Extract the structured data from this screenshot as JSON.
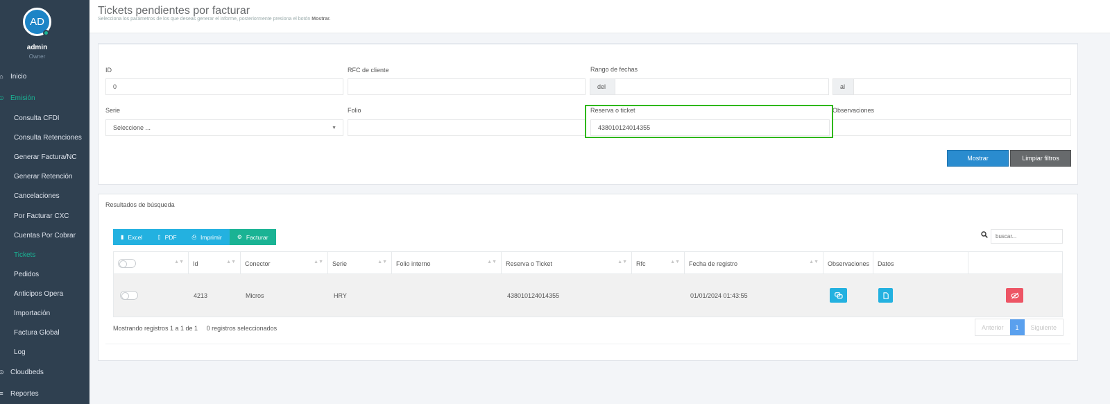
{
  "user": {
    "initials": "AD",
    "name": "admin",
    "role": "Owner"
  },
  "sidebar": {
    "items": [
      {
        "label": "Inicio",
        "icon": "home-icon",
        "glyph": "⌂",
        "level": "top",
        "active": false
      },
      {
        "label": "Emisión",
        "icon": "circle-arrow-icon",
        "glyph": "⊙",
        "level": "top",
        "active": true
      },
      {
        "label": "Consulta CFDI",
        "level": "sub",
        "active": false
      },
      {
        "label": "Consulta Retenciones",
        "level": "sub",
        "active": false
      },
      {
        "label": "Generar Factura/NC",
        "level": "sub",
        "active": false
      },
      {
        "label": "Generar Retención",
        "level": "sub",
        "active": false
      },
      {
        "label": "Cancelaciones",
        "level": "sub",
        "active": false
      },
      {
        "label": "Por Facturar CXC",
        "level": "sub",
        "active": false
      },
      {
        "label": "Cuentas Por Cobrar",
        "level": "sub",
        "active": false
      },
      {
        "label": "Tickets",
        "level": "sub",
        "active": true
      },
      {
        "label": "Pedidos",
        "level": "sub",
        "active": false
      },
      {
        "label": "Anticipos Opera",
        "level": "sub",
        "active": false
      },
      {
        "label": "Importación",
        "level": "sub",
        "active": false
      },
      {
        "label": "Factura Global",
        "level": "sub",
        "active": false
      },
      {
        "label": "Log",
        "level": "sub",
        "active": false
      },
      {
        "label": "Cloudbeds",
        "icon": "circle-arrow-icon",
        "glyph": "⊙",
        "level": "top",
        "active": false
      },
      {
        "label": "Reportes",
        "icon": "list-icon",
        "glyph": "≡",
        "level": "top",
        "active": false
      }
    ]
  },
  "header": {
    "title": "Tickets pendientes por facturar",
    "subtitle_pre": "Selecciona los parámetros de los que deseas generar el informe, posteriormente presiona el botón",
    "subtitle_bold": "Mostrar."
  },
  "filters": {
    "id_label": "ID",
    "id_value": "0",
    "rfc_label": "RFC de cliente",
    "rfc_value": "",
    "range_label": "Rango de fechas",
    "range_from_addon": "del",
    "range_to_addon": "al",
    "serie_label": "Serie",
    "serie_value": "Seleccione ...",
    "folio_label": "Folio",
    "folio_value": "",
    "reserva_label": "Reserva o ticket",
    "reserva_value": "438010124014355",
    "obs_label": "Observaciones",
    "obs_value": "",
    "show_button": "Mostrar",
    "clear_button": "Limpiar filtros"
  },
  "results": {
    "title": "Resultados de búsqueda",
    "toolbar": {
      "excel": "Excel",
      "pdf": "PDF",
      "print": "Imprimir",
      "invoice": "Facturar"
    },
    "search_placeholder": "buscar...",
    "columns": [
      "Id",
      "Conector",
      "Serie",
      "Folio interno",
      "Reserva o Ticket",
      "Rfc",
      "Fecha de registro",
      "Observaciones",
      "Datos"
    ],
    "rows": [
      {
        "id": "4213",
        "conector": "Micros",
        "serie": "HRY",
        "folio_interno": "",
        "reserva": "438010124014355",
        "rfc": "",
        "fecha": "01/01/2024 01:43:55"
      }
    ],
    "info": "Mostrando registros 1 a 1 de 1",
    "selected": "0 registros seleccionados",
    "pager": {
      "prev": "Anterior",
      "current": "1",
      "next": "Siguiente"
    }
  },
  "colors": {
    "sidebar_bg": "#2f4050",
    "accent_green": "#1ab394",
    "primary_blue": "#2a8ccf",
    "info_blue": "#23b1e0",
    "danger_red": "#ed5565",
    "highlight_green": "#2fb81a"
  }
}
